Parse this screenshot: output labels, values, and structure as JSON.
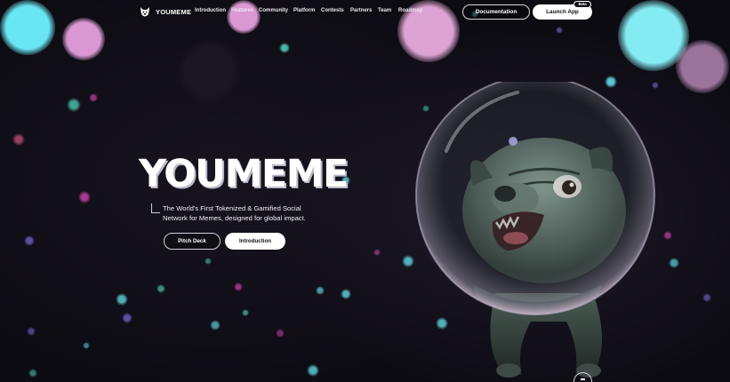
{
  "brand": {
    "name": "YOUMEME",
    "logo_icon": "pug-logo-icon"
  },
  "nav": {
    "links": [
      "Introduction",
      "Features",
      "Community",
      "Platform",
      "Contests",
      "Partners",
      "Team",
      "Roadmap"
    ]
  },
  "actions": {
    "documentation_label": "Documentation",
    "launch_label": "Launch App",
    "beta_label": "Beta"
  },
  "hero": {
    "title": "YOUMEME",
    "tagline": "The World's First Tokenized & Gamified Social Network for Memes, designed for global impact.",
    "pitch_deck_label": "Pitch Deck",
    "introduction_label": "Introduction",
    "illustration": "pug-in-space-helmet",
    "scroll_icon": "scroll-down-icon"
  },
  "colors": {
    "background": "#0d0b12",
    "accent_cyan": "#6ef2ff",
    "accent_pink": "#f0a8e8",
    "button_light": "#ffffff"
  }
}
